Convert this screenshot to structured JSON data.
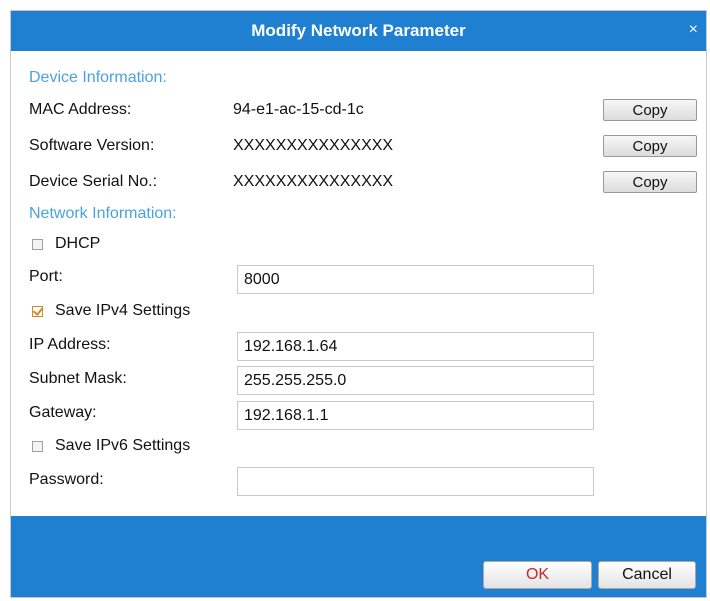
{
  "dialog": {
    "title": "Modify Network Parameter",
    "close_glyph": "×"
  },
  "device_info": {
    "heading": "Device Information:",
    "rows": [
      {
        "label": "MAC Address:",
        "value": "94-e1-ac-15-cd-1c",
        "button": "Copy"
      },
      {
        "label": "Software Version:",
        "value": "XXXXXXXXXXXXXXX",
        "button": "Copy"
      },
      {
        "label": "Device Serial No.:",
        "value": "XXXXXXXXXXXXXXX",
        "button": "Copy"
      }
    ]
  },
  "network_info": {
    "heading": "Network Information:",
    "dhcp": {
      "label": "DHCP",
      "checked": false
    },
    "port": {
      "label": "Port:",
      "value": "8000"
    },
    "save_ipv4": {
      "label": "Save IPv4 Settings",
      "checked": true
    },
    "ip_address": {
      "label": "IP Address:",
      "value": "192.168.1.64"
    },
    "subnet_mask": {
      "label": "Subnet Mask:",
      "value": "255.255.255.0"
    },
    "gateway": {
      "label": "Gateway:",
      "value": "192.168.1.1"
    },
    "save_ipv6": {
      "label": "Save IPv6 Settings",
      "checked": false
    },
    "password": {
      "label": "Password:",
      "value": ""
    }
  },
  "footer": {
    "ok_label": "OK",
    "cancel_label": "Cancel"
  },
  "colors": {
    "title_bar": "#1f7fd0",
    "section_heading": "#4aa3df",
    "ok_text": "#d0242b",
    "checkbox_checked": "#d08a2a"
  }
}
